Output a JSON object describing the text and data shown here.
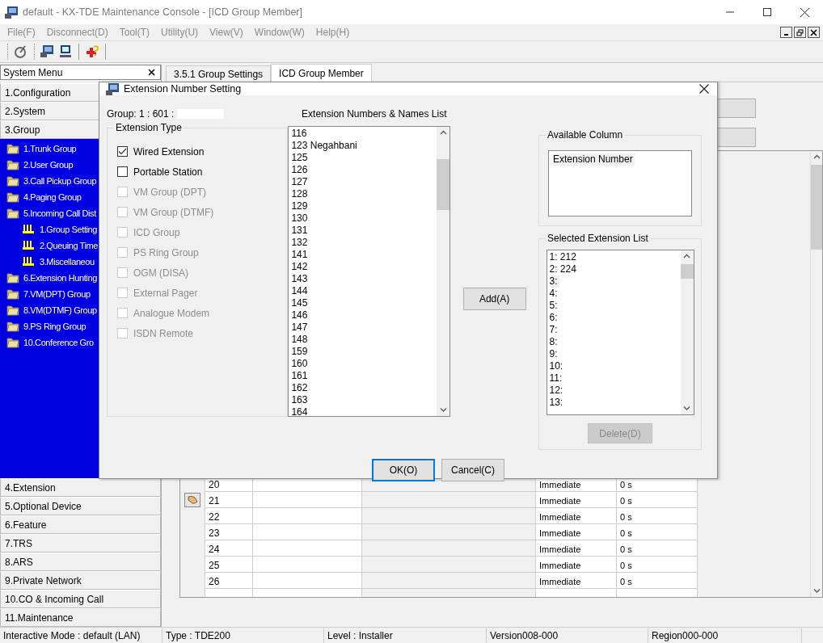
{
  "window": {
    "title": "default - KX-TDE Maintenance Console - [ICD Group Member]"
  },
  "menu_bar": [
    "File(F)",
    "Disconnect(D)",
    "Tool(T)",
    "Utility(U)",
    "View(V)",
    "Window(W)",
    "Help(H)"
  ],
  "system_menu": {
    "title": "System Menu",
    "sections": [
      {
        "label": "1.Configuration"
      },
      {
        "label": "2.System"
      },
      {
        "label": "3.Group",
        "children": [
          {
            "label": "1.Trunk Group"
          },
          {
            "label": "2.User Group"
          },
          {
            "label": "3.Call Pickup Group"
          },
          {
            "label": "4.Paging Group"
          },
          {
            "label": "5.Incoming Call Dist",
            "children": [
              {
                "label": "1.Group Setting"
              },
              {
                "label": "2.Queuing Time"
              },
              {
                "label": "3.Miscellaneou"
              }
            ]
          },
          {
            "label": "6.Extension Hunting"
          },
          {
            "label": "7.VM(DPT) Group"
          },
          {
            "label": "8.VM(DTMF) Group"
          },
          {
            "label": "9.PS Ring Group"
          },
          {
            "label": "10.Conference Gro"
          }
        ]
      },
      {
        "label": "4.Extension"
      },
      {
        "label": "5.Optional Device"
      },
      {
        "label": "6.Feature"
      },
      {
        "label": "7.TRS"
      },
      {
        "label": "8.ARS"
      },
      {
        "label": "9.Private Network"
      },
      {
        "label": "10.CO & Incoming Call"
      },
      {
        "label": "11.Maintenance"
      }
    ]
  },
  "tabs": [
    {
      "label": "3.5.1 Group Settings",
      "selected": false
    },
    {
      "label": "ICD Group Member",
      "selected": true
    }
  ],
  "table": {
    "rows": [
      {
        "number": "20",
        "column_5": "Immediate",
        "column_6": "0 s",
        "current": false
      },
      {
        "number": "21",
        "column_5": "Immediate",
        "column_6": "0 s",
        "current": true
      },
      {
        "number": "22",
        "column_5": "Immediate",
        "column_6": "0 s",
        "current": false
      },
      {
        "number": "23",
        "column_5": "Immediate",
        "column_6": "0 s",
        "current": false
      },
      {
        "number": "24",
        "column_5": "Immediate",
        "column_6": "0 s",
        "current": false
      },
      {
        "number": "25",
        "column_5": "Immediate",
        "column_6": "0 s",
        "current": false
      },
      {
        "number": "26",
        "column_5": "Immediate",
        "column_6": "0 s",
        "current": false
      }
    ]
  },
  "dialog": {
    "title": "Extension Number Setting",
    "group_label": "Group: 1 : 601 :",
    "extension_type": {
      "title": "Extension Type",
      "options": [
        {
          "label": "Wired Extension",
          "checked": true,
          "disabled": false
        },
        {
          "label": "Portable Station",
          "checked": false,
          "disabled": false
        },
        {
          "label": "VM Group (DPT)",
          "checked": false,
          "disabled": true
        },
        {
          "label": "VM Group (DTMF)",
          "checked": false,
          "disabled": true
        },
        {
          "label": "ICD Group",
          "checked": false,
          "disabled": true
        },
        {
          "label": "PS Ring Group",
          "checked": false,
          "disabled": true
        },
        {
          "label": "OGM (DISA)",
          "checked": false,
          "disabled": true
        },
        {
          "label": "External Pager",
          "checked": false,
          "disabled": true
        },
        {
          "label": "Analogue Modem",
          "checked": false,
          "disabled": true
        },
        {
          "label": "ISDN Remote",
          "checked": false,
          "disabled": true
        }
      ]
    },
    "list_title": "Extension Numbers & Names List",
    "extension_list": [
      "116",
      "123 Negahbani",
      "125",
      "126",
      "127",
      "128",
      "129",
      "130",
      "131",
      "132",
      "141",
      "142",
      "143",
      "144",
      "145",
      "146",
      "147",
      "148",
      "159",
      "160",
      "161",
      "162",
      "163",
      "164"
    ],
    "add_button": "Add(A)",
    "available_column": {
      "title": "Available Column",
      "items": [
        {
          "label": "Extension Number",
          "selected": true
        }
      ]
    },
    "selected_list": {
      "title": "Selected Extension List",
      "items": [
        {
          "label": "1: 212",
          "selected": false
        },
        {
          "label": "2: 224",
          "selected": false
        },
        {
          "label": "3:",
          "selected": true
        },
        {
          "label": "4:",
          "selected": false
        },
        {
          "label": "5:",
          "selected": false
        },
        {
          "label": "6:",
          "selected": false
        },
        {
          "label": "7:",
          "selected": false
        },
        {
          "label": "8:",
          "selected": false
        },
        {
          "label": "9:",
          "selected": false
        },
        {
          "label": "10:",
          "selected": false
        },
        {
          "label": "11:",
          "selected": false
        },
        {
          "label": "12:",
          "selected": false
        },
        {
          "label": "13:",
          "selected": false
        }
      ]
    },
    "delete_button": {
      "label": "Delete(D)",
      "disabled": true
    },
    "ok_button": {
      "label": "OK(O)",
      "default": true
    },
    "cancel_button": {
      "label": "Cancel(C)",
      "default": false
    }
  },
  "status_bar": [
    "Interactive Mode : default (LAN)",
    "Type : TDE200",
    "Level : Installer",
    "Version008-000",
    "Region000-000"
  ]
}
